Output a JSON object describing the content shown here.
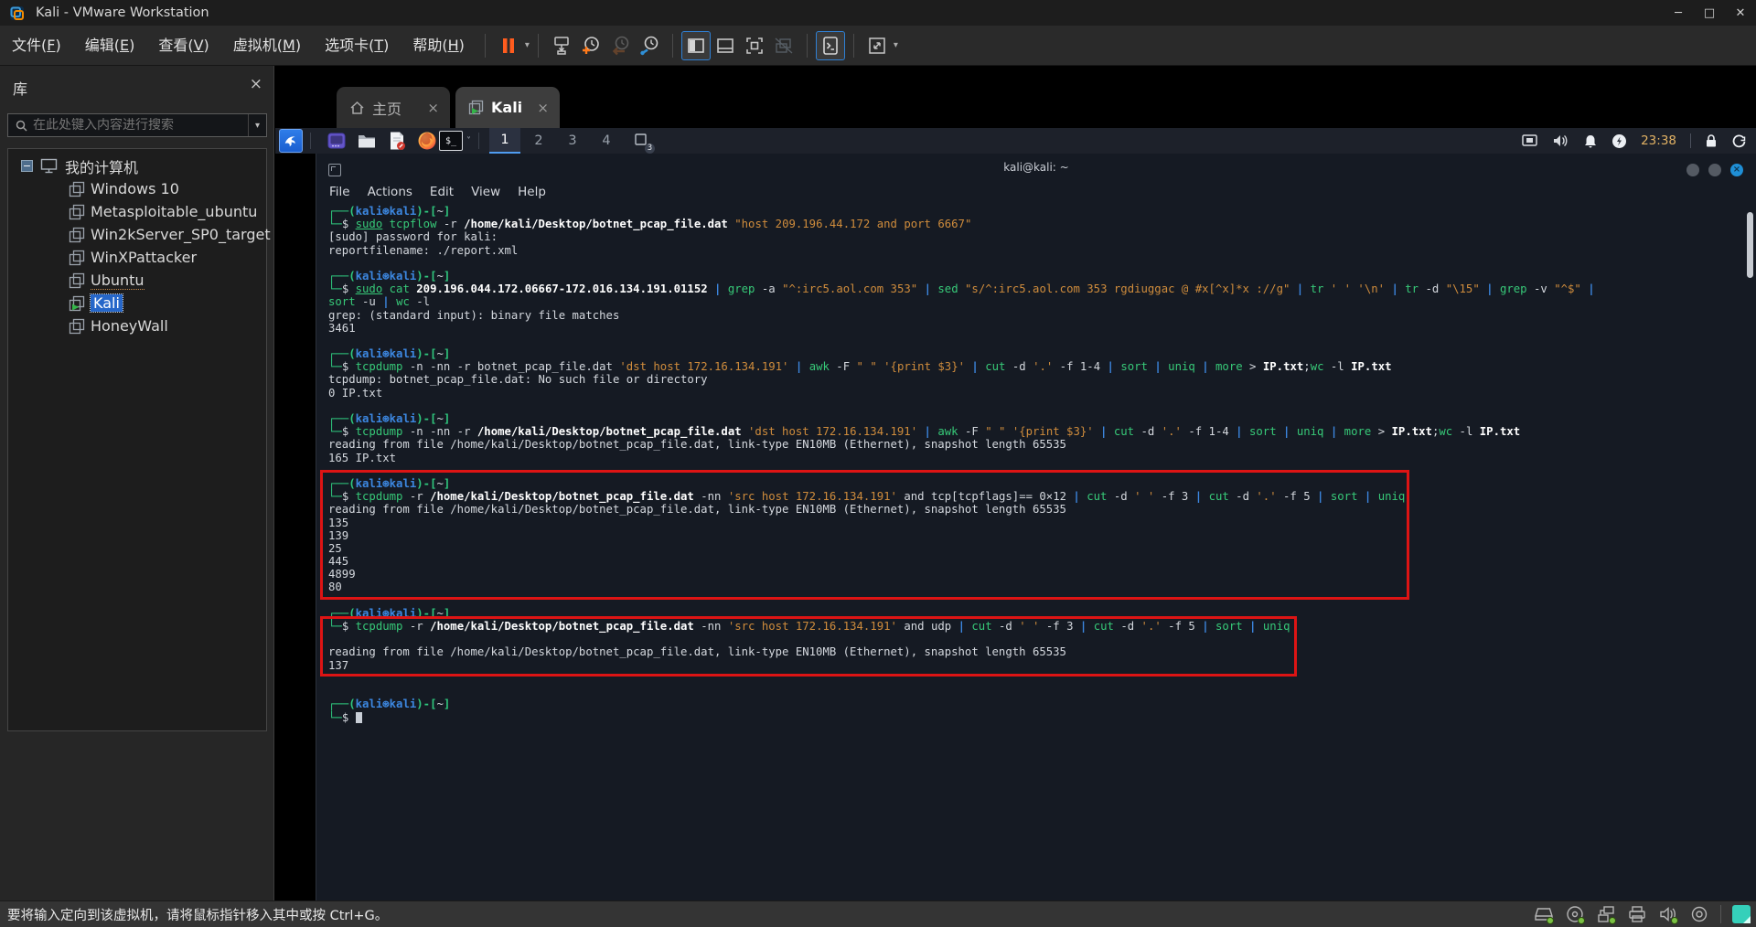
{
  "window": {
    "title": "Kali - VMware Workstation",
    "min_glyph": "─",
    "max_glyph": "□",
    "close_glyph": "✕"
  },
  "glyphs": {
    "close": "×",
    "caret": "▾",
    "expander": "−"
  },
  "menubar": {
    "items": [
      {
        "key": "file",
        "label": "文件(F)"
      },
      {
        "key": "edit",
        "label": "编辑(E)"
      },
      {
        "key": "view",
        "label": "查看(V)"
      },
      {
        "key": "vm",
        "label": "虚拟机(M)"
      },
      {
        "key": "tabs",
        "label": "选项卡(T)"
      },
      {
        "key": "help",
        "label": "帮助(H)"
      }
    ]
  },
  "toolbar": {
    "icons": [
      "pause-button",
      "pause-caret",
      "send-to-vm-icon",
      "snapshot-take-icon",
      "snapshot-revert-icon",
      "snapshot-manager-icon",
      "library-panel-toggle",
      "thumbnail-bar-toggle",
      "fullscreen-toggle",
      "unity-mode-toggle",
      "console-view-toggle",
      "stretch-view-toggle"
    ]
  },
  "sidebar": {
    "title": "库",
    "search_placeholder": "在此处键入内容进行搜索",
    "root_label": "我的计算机",
    "vms": [
      {
        "name": "Windows 10"
      },
      {
        "name": "Metasploitable_ubuntu"
      },
      {
        "name": "Win2kServer_SP0_target"
      },
      {
        "name": "WinXPattacker"
      },
      {
        "name": "Ubuntu",
        "focus": true
      },
      {
        "name": "Kali",
        "selected": true,
        "running": true
      },
      {
        "name": "HoneyWall"
      }
    ]
  },
  "tabs": [
    {
      "label": "主页"
    },
    {
      "label": "Kali",
      "active": true
    }
  ],
  "kali_panel": {
    "workspaces": [
      "1",
      "2",
      "3",
      "4"
    ],
    "active_workspace": "1",
    "window_count_badge": "3",
    "clock": "23:38",
    "terminal_glyph": "$_"
  },
  "terminal": {
    "title": "kali@kali: ~",
    "menu": [
      "File",
      "Actions",
      "Edit",
      "View",
      "Help"
    ],
    "lines": [
      [
        [
          "f",
          "┌──("
        ],
        [
          "u",
          "kali⊛kali"
        ],
        [
          "f",
          ")-["
        ],
        [
          "w",
          "~"
        ],
        [
          "f",
          "]"
        ]
      ],
      [
        [
          "f",
          "└─"
        ],
        [
          "w",
          "$ "
        ],
        [
          "gu",
          "sudo"
        ],
        [
          "g",
          " tcpflow"
        ],
        [
          "w",
          " -r "
        ],
        [
          "W",
          "/home/kali/Desktop/botnet_pcap_file.dat"
        ],
        [
          "o",
          " \"host 209.196.44.172 and port 6667\""
        ]
      ],
      [
        [
          "w",
          "[sudo] password for kali:"
        ]
      ],
      [
        [
          "w",
          "reportfilename: ./report.xml"
        ]
      ],
      [],
      [
        [
          "f",
          "┌──("
        ],
        [
          "u",
          "kali⊛kali"
        ],
        [
          "f",
          ")-["
        ],
        [
          "w",
          "~"
        ],
        [
          "f",
          "]"
        ]
      ],
      [
        [
          "f",
          "└─"
        ],
        [
          "w",
          "$ "
        ],
        [
          "gu",
          "sudo"
        ],
        [
          "g",
          " cat"
        ],
        [
          "W",
          " 209.196.044.172.06667-172.016.134.191.01152"
        ],
        [
          "b",
          " | "
        ],
        [
          "g",
          "grep"
        ],
        [
          "w",
          " -a "
        ],
        [
          "o",
          "\"^:irc5.aol.com 353\""
        ],
        [
          "b",
          " | "
        ],
        [
          "g",
          "sed"
        ],
        [
          "o",
          " \"s/^:irc5.aol.com 353 rgdiuggac @ #x[^x]*x ://g\""
        ],
        [
          "b",
          " | "
        ],
        [
          "g",
          "tr"
        ],
        [
          "o",
          " ' ' '\\n'"
        ],
        [
          "b",
          " | "
        ],
        [
          "g",
          "tr"
        ],
        [
          "w",
          " -d "
        ],
        [
          "o",
          "\"\\15\""
        ],
        [
          "b",
          " | "
        ],
        [
          "g",
          "grep"
        ],
        [
          "w",
          " -v "
        ],
        [
          "o",
          "\"^$\""
        ],
        [
          "b",
          " |"
        ]
      ],
      [
        [
          "g",
          "sort"
        ],
        [
          "w",
          " -u "
        ],
        [
          "b",
          "| "
        ],
        [
          "g",
          "wc"
        ],
        [
          "w",
          " -l"
        ]
      ],
      [
        [
          "w",
          "grep: (standard input): binary file matches"
        ]
      ],
      [
        [
          "w",
          "3461"
        ]
      ],
      [],
      [
        [
          "f",
          "┌──("
        ],
        [
          "u",
          "kali⊛kali"
        ],
        [
          "f",
          ")-["
        ],
        [
          "w",
          "~"
        ],
        [
          "f",
          "]"
        ]
      ],
      [
        [
          "f",
          "└─"
        ],
        [
          "w",
          "$ "
        ],
        [
          "g",
          "tcpdump"
        ],
        [
          "w",
          " -n -nn -r botnet_pcap_file.dat "
        ],
        [
          "o",
          "'dst host 172.16.134.191'"
        ],
        [
          "b",
          " | "
        ],
        [
          "g",
          "awk"
        ],
        [
          "w",
          " -F "
        ],
        [
          "o",
          "\" \""
        ],
        [
          "w",
          " "
        ],
        [
          "o",
          "'{print $3}'"
        ],
        [
          "b",
          " | "
        ],
        [
          "g",
          "cut"
        ],
        [
          "w",
          " -d "
        ],
        [
          "o",
          "'.'"
        ],
        [
          "w",
          " -f 1-4"
        ],
        [
          "b",
          " | "
        ],
        [
          "g",
          "sort"
        ],
        [
          "b",
          " | "
        ],
        [
          "g",
          "uniq"
        ],
        [
          "b",
          " | "
        ],
        [
          "g",
          "more"
        ],
        [
          "w",
          " > "
        ],
        [
          "W",
          "IP.txt"
        ],
        [
          "w",
          ";"
        ],
        [
          "g",
          "wc"
        ],
        [
          "w",
          " -l "
        ],
        [
          "W",
          "IP.txt"
        ]
      ],
      [
        [
          "w",
          "tcpdump: botnet_pcap_file.dat: No such file or directory"
        ]
      ],
      [
        [
          "w",
          "0 IP.txt"
        ]
      ],
      [],
      [
        [
          "f",
          "┌──("
        ],
        [
          "u",
          "kali⊛kali"
        ],
        [
          "f",
          ")-["
        ],
        [
          "w",
          "~"
        ],
        [
          "f",
          "]"
        ]
      ],
      [
        [
          "f",
          "└─"
        ],
        [
          "w",
          "$ "
        ],
        [
          "g",
          "tcpdump"
        ],
        [
          "w",
          " -n -nn -r "
        ],
        [
          "W",
          "/home/kali/Desktop/botnet_pcap_file.dat"
        ],
        [
          "w",
          " "
        ],
        [
          "o",
          "'dst host 172.16.134.191'"
        ],
        [
          "b",
          " | "
        ],
        [
          "g",
          "awk"
        ],
        [
          "w",
          " -F "
        ],
        [
          "o",
          "\" \""
        ],
        [
          "w",
          " "
        ],
        [
          "o",
          "'{print $3}'"
        ],
        [
          "b",
          " | "
        ],
        [
          "g",
          "cut"
        ],
        [
          "w",
          " -d "
        ],
        [
          "o",
          "'.'"
        ],
        [
          "w",
          " -f 1-4"
        ],
        [
          "b",
          " | "
        ],
        [
          "g",
          "sort"
        ],
        [
          "b",
          " | "
        ],
        [
          "g",
          "uniq"
        ],
        [
          "b",
          " | "
        ],
        [
          "g",
          "more"
        ],
        [
          "w",
          " > "
        ],
        [
          "W",
          "IP.txt"
        ],
        [
          "w",
          ";"
        ],
        [
          "g",
          "wc"
        ],
        [
          "w",
          " -l "
        ],
        [
          "W",
          "IP.txt"
        ]
      ],
      [
        [
          "w",
          "reading from file /home/kali/Desktop/botnet_pcap_file.dat, link-type EN10MB (Ethernet), snapshot length 65535"
        ]
      ],
      [
        [
          "w",
          "165 IP.txt"
        ]
      ],
      [],
      [
        [
          "f",
          "┌──("
        ],
        [
          "u",
          "kali⊛kali"
        ],
        [
          "f",
          ")-["
        ],
        [
          "w",
          "~"
        ],
        [
          "f",
          "]"
        ]
      ],
      [
        [
          "f",
          "└─"
        ],
        [
          "w",
          "$ "
        ],
        [
          "g",
          "tcpdump"
        ],
        [
          "w",
          " -r "
        ],
        [
          "W",
          "/home/kali/Desktop/botnet_pcap_file.dat"
        ],
        [
          "w",
          " -nn "
        ],
        [
          "o",
          "'src host 172.16.134.191'"
        ],
        [
          "w",
          " and tcp[tcpflags]== 0×12"
        ],
        [
          "b",
          " | "
        ],
        [
          "g",
          "cut"
        ],
        [
          "w",
          " -d "
        ],
        [
          "o",
          "' '"
        ],
        [
          "w",
          " -f 3"
        ],
        [
          "b",
          " | "
        ],
        [
          "g",
          "cut"
        ],
        [
          "w",
          " -d "
        ],
        [
          "o",
          "'.'"
        ],
        [
          "w",
          " -f 5"
        ],
        [
          "b",
          " | "
        ],
        [
          "g",
          "sort"
        ],
        [
          "b",
          " | "
        ],
        [
          "g",
          "uniq"
        ]
      ],
      [
        [
          "w",
          "reading from file /home/kali/Desktop/botnet_pcap_file.dat, link-type EN10MB (Ethernet), snapshot length 65535"
        ]
      ],
      [
        [
          "w",
          "135"
        ]
      ],
      [
        [
          "w",
          "139"
        ]
      ],
      [
        [
          "w",
          "25"
        ]
      ],
      [
        [
          "w",
          "445"
        ]
      ],
      [
        [
          "w",
          "4899"
        ]
      ],
      [
        [
          "w",
          "80"
        ]
      ],
      [],
      [
        [
          "f",
          "┌──("
        ],
        [
          "u",
          "kali⊛kali"
        ],
        [
          "f",
          ")-["
        ],
        [
          "w",
          "~"
        ],
        [
          "f",
          "]"
        ]
      ],
      [
        [
          "f",
          "└─"
        ],
        [
          "w",
          "$ "
        ],
        [
          "g",
          "tcpdump"
        ],
        [
          "w",
          " -r "
        ],
        [
          "W",
          "/home/kali/Desktop/botnet_pcap_file.dat"
        ],
        [
          "w",
          " -nn "
        ],
        [
          "o",
          "'src host 172.16.134.191'"
        ],
        [
          "w",
          " and udp"
        ],
        [
          "b",
          " | "
        ],
        [
          "g",
          "cut"
        ],
        [
          "w",
          " -d "
        ],
        [
          "o",
          "' '"
        ],
        [
          "w",
          " -f 3"
        ],
        [
          "b",
          " | "
        ],
        [
          "g",
          "cut"
        ],
        [
          "w",
          " -d "
        ],
        [
          "o",
          "'.'"
        ],
        [
          "w",
          " -f 5"
        ],
        [
          "b",
          " | "
        ],
        [
          "g",
          "sort"
        ],
        [
          "b",
          " | "
        ],
        [
          "g",
          "uniq"
        ]
      ],
      [],
      [
        [
          "w",
          "reading from file /home/kali/Desktop/botnet_pcap_file.dat, link-type EN10MB (Ethernet), snapshot length 65535"
        ]
      ],
      [
        [
          "w",
          "137"
        ]
      ],
      [],
      [],
      [
        [
          "f",
          "┌──("
        ],
        [
          "u",
          "kali⊛kali"
        ],
        [
          "f",
          ")-["
        ],
        [
          "w",
          "~"
        ],
        [
          "f",
          "]"
        ]
      ],
      [
        [
          "f",
          "└─"
        ],
        [
          "w",
          "$ "
        ],
        [
          "c",
          ""
        ]
      ]
    ]
  },
  "statusbar": {
    "message": "要将输入定向到该虚拟机，请将鼠标指针移入其中或按 Ctrl+G。",
    "devices": [
      "hard-disk",
      "cdrom",
      "network-adapter",
      "printer",
      "sound",
      "webcam"
    ]
  },
  "colors": {
    "annotation_red": "#dd1414",
    "selection_blue": "#2667c9",
    "prompt_green": "#2fc87e",
    "user_blue": "#3c87e0",
    "string_orange": "#cf8c3c",
    "kali_logo_blue": "#2573e8",
    "active_workspace_underline": "#4f9cf0",
    "clock_amber": "#e2b264",
    "device_ok_green": "#7ac143",
    "notification_teal": "#35d0ba"
  }
}
